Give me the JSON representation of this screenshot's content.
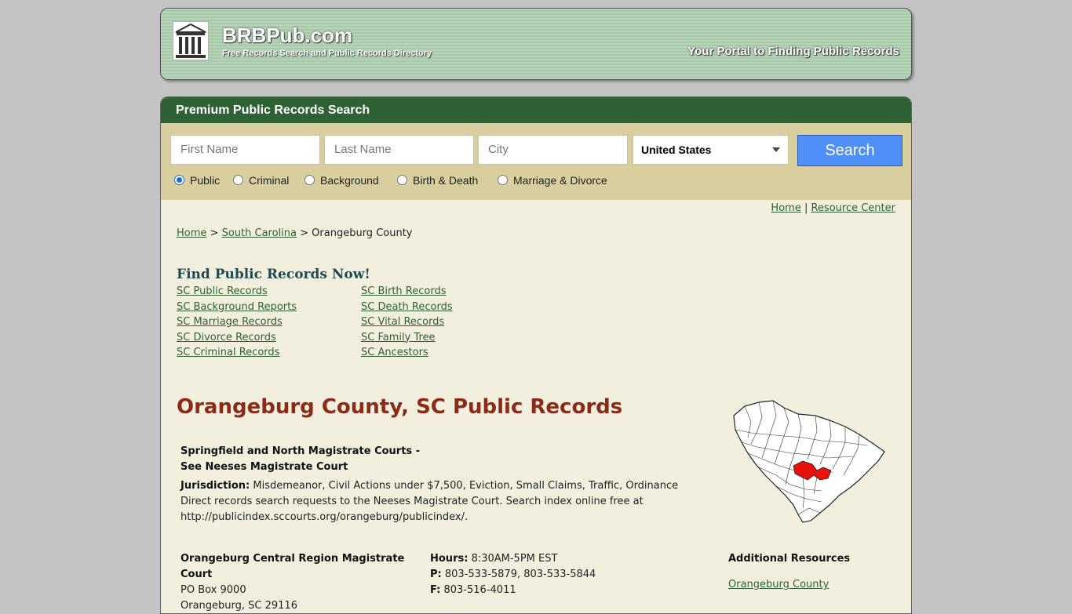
{
  "header": {
    "site_title": "BRBPub.com",
    "site_subtitle": "Free Records Search and Public Records Directory",
    "tagline": "Your Portal to Finding Public Records"
  },
  "search": {
    "heading": "Premium Public Records Search",
    "first_name_placeholder": "First Name",
    "last_name_placeholder": "Last Name",
    "city_placeholder": "City",
    "country_value": "United States",
    "button_label": "Search",
    "record_types": [
      "Public",
      "Criminal",
      "Background",
      "Birth & Death",
      "Marriage & Divorce"
    ],
    "selected_type": "Public"
  },
  "top_links": {
    "home": "Home",
    "separator": "|",
    "resource_center": "Resource Center"
  },
  "breadcrumb": {
    "home": "Home",
    "sep": ">",
    "state": "South Carolina",
    "current": "Orangeburg County"
  },
  "find_records": {
    "title": "Find Public Records Now!",
    "left": [
      "SC Public Records",
      "SC Background Reports",
      "SC Marriage Records",
      "SC Divorce Records",
      "SC Criminal Records"
    ],
    "right": [
      "SC Birth Records",
      "SC Death Records",
      "SC Vital Records",
      "SC Family Tree",
      "SC Ancestors"
    ]
  },
  "county": {
    "title": "Orangeburg County, SC Public Records",
    "highlight_color": "#e8120c"
  },
  "entry1": {
    "name_line1": "Springfield and North Magistrate Courts -",
    "name_line2": "See Neeses Magistrate Court",
    "jurisdiction_label": "Jurisdiction:",
    "jurisdiction": "Misdemeanor, Civil Actions under $7,500, Eviction, Small Claims, Traffic, Ordinance",
    "note_line1": "Direct records search requests to the Neeses Magistrate Court. Search index online free at",
    "note_line2": "http://publicindex.sccourts.org/orangeburg/publicindex/."
  },
  "entry2": {
    "name_line1": "Orangeburg Central Region Magistrate",
    "name_line2": "Court",
    "address1": "PO Box 9000",
    "address2": "Orangeburg, SC 29116",
    "hours_label": "Hours:",
    "hours": "8:30AM-5PM EST",
    "phone_label": "P:",
    "phone": "803-533-5879, 803-533-5844",
    "fax_label": "F:",
    "fax": "803-516-4011"
  },
  "additional": {
    "title": "Additional Resources",
    "link": "Orangeburg County"
  }
}
